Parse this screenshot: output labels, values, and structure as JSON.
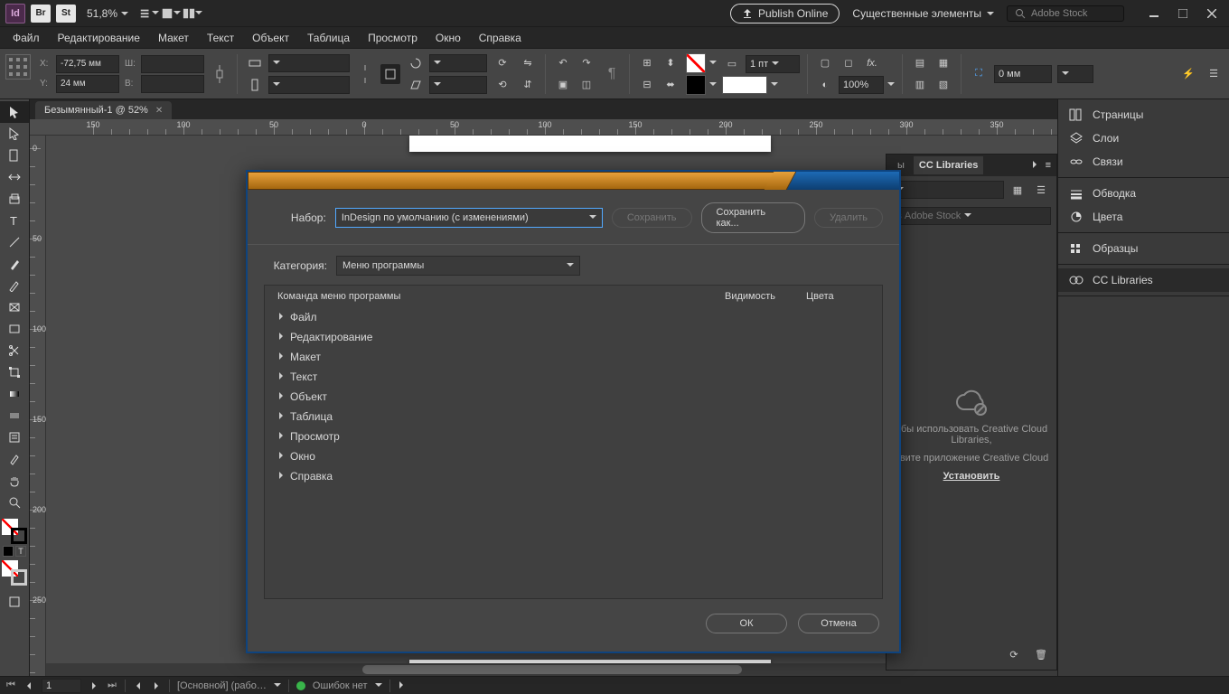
{
  "titlebar": {
    "app": "Id",
    "br": "Br",
    "st": "St",
    "zoom": "51,8%",
    "publish": "Publish Online",
    "workspace": "Существенные элементы",
    "search_placeholder": "Adobe Stock"
  },
  "menu": [
    "Файл",
    "Редактирование",
    "Макет",
    "Текст",
    "Объект",
    "Таблица",
    "Просмотр",
    "Окно",
    "Справка"
  ],
  "control": {
    "x": "-72,75 мм",
    "y": "24 мм",
    "w": "",
    "h": "",
    "stroke_w": "1 пт",
    "scale": "100%",
    "gap": "0 мм",
    "lbl_x": "X:",
    "lbl_y": "Y:",
    "lbl_w": "Ш:",
    "lbl_h": "В:"
  },
  "doc": {
    "tab": "Безымянный-1 @ 52%",
    "ruler_h": [
      "150",
      "100",
      "50",
      "0",
      "50",
      "100",
      "150",
      "200",
      "250",
      "300",
      "350"
    ],
    "ruler_v": [
      "0",
      "50",
      "100",
      "150",
      "200",
      "250"
    ]
  },
  "panels": {
    "group1": [
      {
        "icon": "pages",
        "label": "Страницы"
      },
      {
        "icon": "layers",
        "label": "Слои"
      },
      {
        "icon": "links",
        "label": "Связи"
      }
    ],
    "group2": [
      {
        "icon": "stroke",
        "label": "Обводка"
      },
      {
        "icon": "color",
        "label": "Цвета"
      }
    ],
    "group3": [
      {
        "icon": "swatches",
        "label": "Образцы"
      }
    ],
    "group4": [
      {
        "icon": "cc",
        "label": "CC Libraries"
      }
    ]
  },
  "cc": {
    "tab_other": "ы",
    "tab_active": "CC Libraries",
    "search_placeholder": "в Adobe Stock",
    "msg1": "обы использовать Creative Cloud Libraries,",
    "msg2": "овите приложение Creative Cloud",
    "install": "Установить"
  },
  "dialog": {
    "set_label": "Набор:",
    "set_value": "InDesign по умолчанию (с изменениями)",
    "save": "Сохранить",
    "save_as": "Сохранить как...",
    "delete": "Удалить",
    "cat_label": "Категория:",
    "cat_value": "Меню программы",
    "th_cmd": "Команда меню программы",
    "th_vis": "Видимость",
    "th_col": "Цвета",
    "rows": [
      "Файл",
      "Редактирование",
      "Макет",
      "Текст",
      "Объект",
      "Таблица",
      "Просмотр",
      "Окно",
      "Справка"
    ],
    "ok": "ОК",
    "cancel": "Отмена"
  },
  "status": {
    "page": "1",
    "master": "[Основной] (рабо…",
    "errors": "Ошибок нет"
  }
}
